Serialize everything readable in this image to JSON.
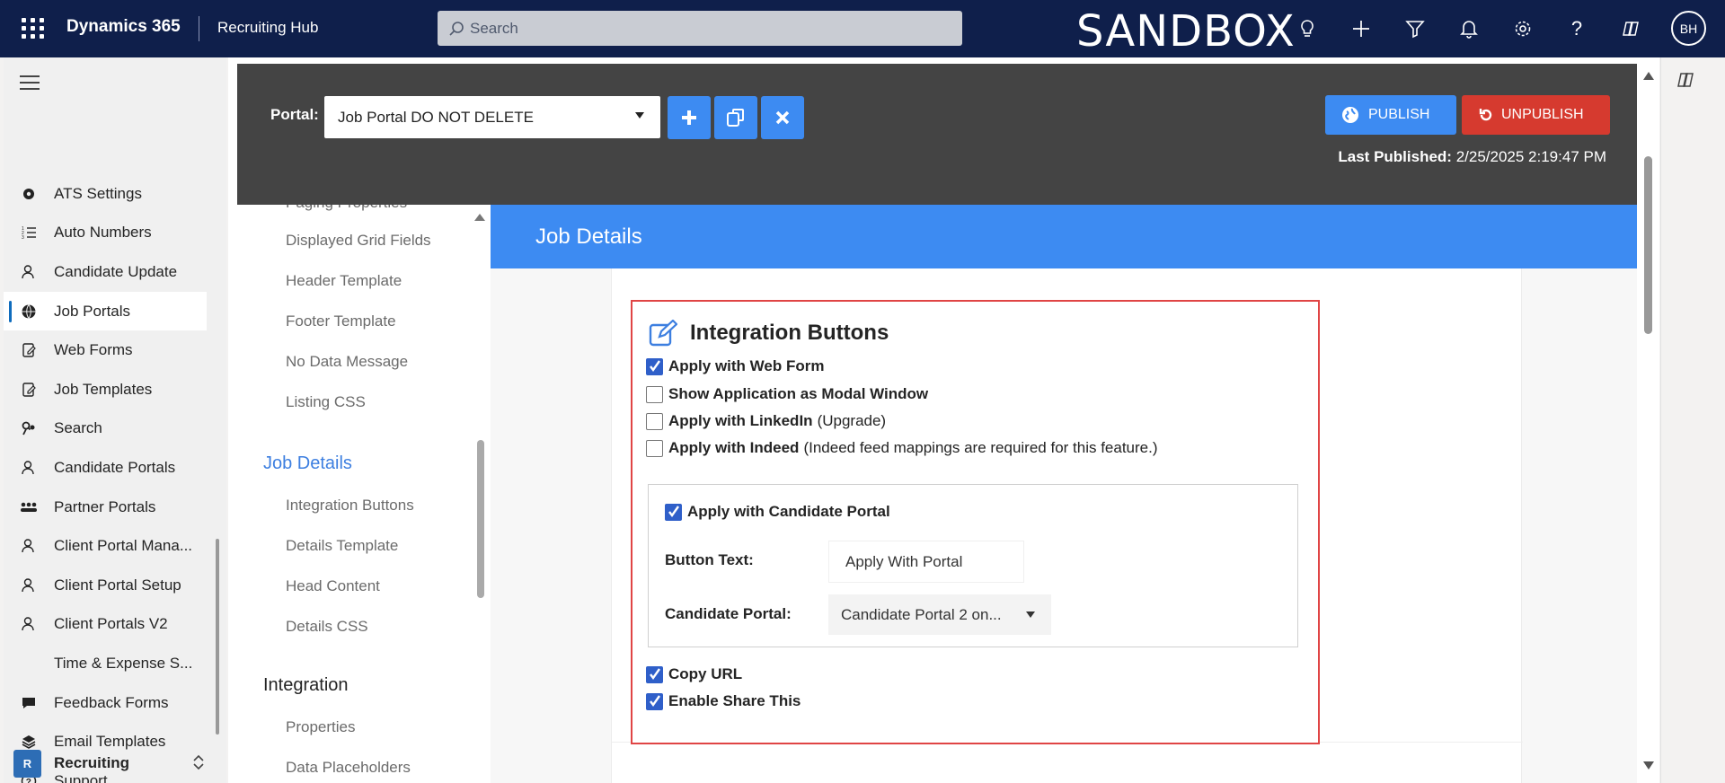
{
  "topbar": {
    "brand": "Dynamics 365",
    "app_name": "Recruiting Hub",
    "search_placeholder": "Search",
    "environment": "SANDBOX",
    "avatar_initials": "BH",
    "icons": [
      "lightbulb-icon",
      "plus-icon",
      "filter-icon",
      "bell-icon",
      "gear-icon",
      "help-icon",
      "copilot-icon"
    ]
  },
  "leftnav": {
    "items": [
      {
        "label": "ATS Settings",
        "icon": "gear-icon"
      },
      {
        "label": "Auto Numbers",
        "icon": "numbered-list-icon"
      },
      {
        "label": "Candidate Update",
        "icon": "person-sync-icon"
      },
      {
        "label": "Job Portals",
        "icon": "globe-icon",
        "active": true
      },
      {
        "label": "Web Forms",
        "icon": "form-edit-icon"
      },
      {
        "label": "Job Templates",
        "icon": "template-icon"
      },
      {
        "label": "Search",
        "icon": "search-people-icon"
      },
      {
        "label": "Candidate Portals",
        "icon": "people-icon"
      },
      {
        "label": "Partner Portals",
        "icon": "group-icon"
      },
      {
        "label": "Client Portal Mana...",
        "icon": "person-tree-icon"
      },
      {
        "label": "Client Portal Setup",
        "icon": "person-icon"
      },
      {
        "label": "Client Portals V2",
        "icon": "person-icon"
      },
      {
        "label": "Time & Expense S...",
        "icon": ""
      },
      {
        "label": "Feedback Forms",
        "icon": "feedback-icon"
      },
      {
        "label": "Email Templates",
        "icon": "layers-icon"
      },
      {
        "label": "Support",
        "icon": "question-circle-icon"
      }
    ],
    "area_badge": "R",
    "area_label": "Recruiting"
  },
  "portal": {
    "label": "Portal:",
    "selected": "Job Portal DO NOT DELETE",
    "publish_label": "PUBLISH",
    "unpublish_label": "UNPUBLISH",
    "last_published_label": "Last Published:",
    "last_published_value": "2/25/2025 2:19:47 PM",
    "colors": {
      "blue": "#3d8bf2",
      "red": "#d63a2f"
    }
  },
  "sections": {
    "cut_item": "Paging Properties",
    "items_top": [
      "Displayed Grid Fields",
      "Header Template",
      "Footer Template",
      "No Data Message",
      "Listing CSS"
    ],
    "job_details_heading": "Job Details",
    "job_details_items": [
      "Integration Buttons",
      "Details Template",
      "Head Content",
      "Details CSS"
    ],
    "integration_heading": "Integration",
    "integration_items": [
      "Properties",
      "Data Placeholders"
    ]
  },
  "job_details": {
    "header": "Job Details",
    "panel_title": "Integration Buttons",
    "checkboxes": [
      {
        "label": "Apply with Web Form",
        "note": "",
        "checked": true
      },
      {
        "label": "Show Application as Modal Window",
        "note": "",
        "checked": false
      },
      {
        "label": "Apply with LinkedIn",
        "note": "(Upgrade)",
        "checked": false
      },
      {
        "label": "Apply with Indeed",
        "note": "(Indeed feed mappings are required for this feature.)",
        "checked": false
      }
    ],
    "candidate_portal": {
      "checkbox_label": "Apply with Candidate Portal",
      "checked": true,
      "button_text_label": "Button Text:",
      "button_text_value": "Apply With Portal",
      "portal_label": "Candidate Portal:",
      "portal_value": "Candidate Portal 2 on..."
    },
    "bottom_checkboxes": [
      {
        "label": "Copy URL",
        "checked": true
      },
      {
        "label": "Enable Share This",
        "checked": true
      }
    ]
  }
}
